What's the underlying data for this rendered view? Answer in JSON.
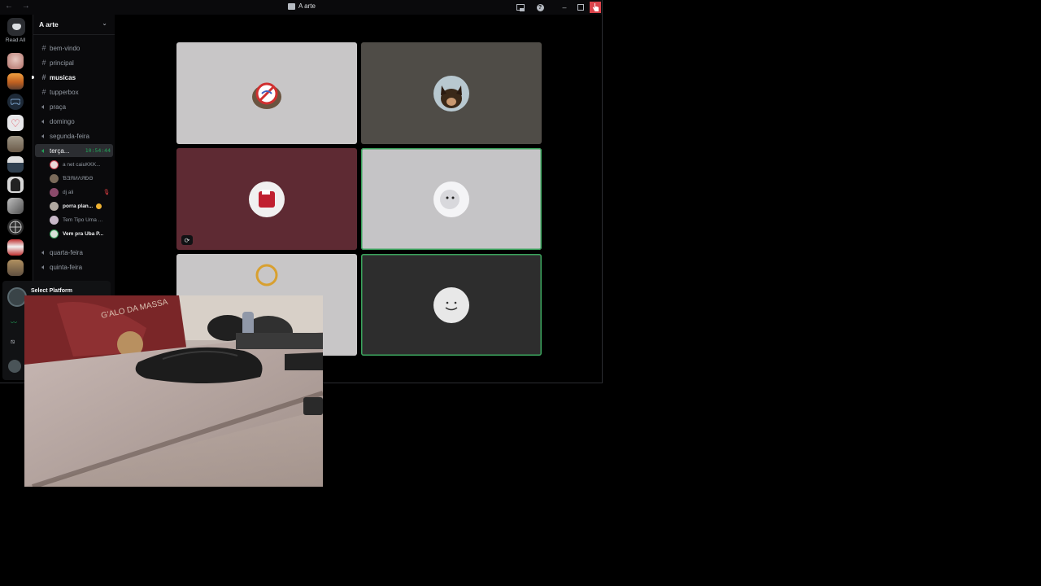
{
  "window": {
    "title": "A arte",
    "nav_arrows": "← →"
  },
  "titlebar_icons": [
    "inbox-icon",
    "help-icon",
    "minimize-icon",
    "maximize-icon",
    "close-icon"
  ],
  "server_rail": {
    "read_all_label": "Read All"
  },
  "guild": {
    "name": "A arte",
    "menu_chevron": "⌄"
  },
  "channels": [
    {
      "name": "bem-vindo",
      "type": "text",
      "unread": false
    },
    {
      "name": "principal",
      "type": "text",
      "unread": false
    },
    {
      "name": "musicas",
      "type": "text",
      "unread": true
    },
    {
      "name": "tupperbox",
      "type": "text",
      "unread": false
    },
    {
      "name": "praça",
      "type": "voice",
      "unread": false
    },
    {
      "name": "domingo",
      "type": "voice",
      "unread": false
    },
    {
      "name": "segunda-feira",
      "type": "voice",
      "unread": false
    },
    {
      "name": "terça...",
      "type": "voice",
      "active": true,
      "timer": "10:54:44"
    },
    {
      "name": "quarta-feira",
      "type": "voice",
      "unread": false
    },
    {
      "name": "quinta-feira",
      "type": "voice",
      "unread": false
    }
  ],
  "voice_members": [
    {
      "name": "a net caiuKKK...",
      "speaking": false
    },
    {
      "name": "ƁƎЯИΛЯÐΘ",
      "speaking": false
    },
    {
      "name": "dj ali",
      "speaking": false,
      "muted": true
    },
    {
      "name": "porra plan...",
      "speaking": true,
      "badge": true
    },
    {
      "name": "Tem Tipo Uma ...",
      "speaking": false
    },
    {
      "name": "Vem pra Uba P...",
      "speaking": true
    }
  ],
  "overlay": {
    "title": "Select Platform"
  },
  "tiles": [
    {
      "bg": "#c8c6c7",
      "speaking": false,
      "avatar": "no-wifi-cat-avatar"
    },
    {
      "bg": "#4f4c47",
      "speaking": false,
      "avatar": "puppy-avatar"
    },
    {
      "bg": "#5e2a33",
      "speaking": false,
      "avatar": "red-sticker-avatar",
      "has_stream_icon": true
    },
    {
      "bg": "#c5c4c6",
      "speaking": true,
      "avatar": "plush-avatar"
    },
    {
      "bg": "#c8c6c7",
      "speaking": false,
      "avatar": "partial-avatar"
    },
    {
      "bg": "#2d2d2d",
      "speaking": true,
      "avatar": "smiley-avatar"
    }
  ],
  "colors": {
    "accent_green": "#23a55a",
    "close_red": "#d9444b"
  }
}
